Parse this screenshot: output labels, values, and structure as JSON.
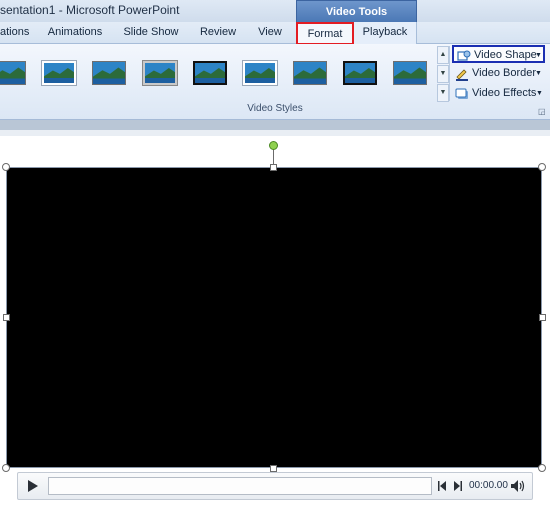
{
  "window": {
    "title": "sentation1  -  Microsoft PowerPoint",
    "contextual_tab_group": "Video Tools"
  },
  "tabs": [
    {
      "label": "ations"
    },
    {
      "label": "Animations"
    },
    {
      "label": "Slide Show"
    },
    {
      "label": "Review"
    },
    {
      "label": "View"
    },
    {
      "label": "Format",
      "selected": true
    },
    {
      "label": "Playback"
    }
  ],
  "ribbon": {
    "group_label": "Video Styles",
    "gallery_scroll": {
      "up": "▲",
      "down": "▼",
      "more": "▼"
    },
    "commands": {
      "video_shape": "Video Shape",
      "video_border": "Video Border",
      "video_effects": "Video Effects"
    }
  },
  "player": {
    "time": "00:00.00"
  },
  "colors": {
    "highlight_format_tab": "#e31c23",
    "highlight_video_shape": "#1b2fb2",
    "video_background": "#000000",
    "contextual_tab": "#4b78b5"
  },
  "icons": {
    "play": "play-icon",
    "skip_back": "skip-back-icon",
    "skip_forward": "skip-forward-icon",
    "volume": "volume-icon",
    "video_shape": "video-shape-icon",
    "video_border": "video-border-icon",
    "video_effects": "video-effects-icon"
  }
}
